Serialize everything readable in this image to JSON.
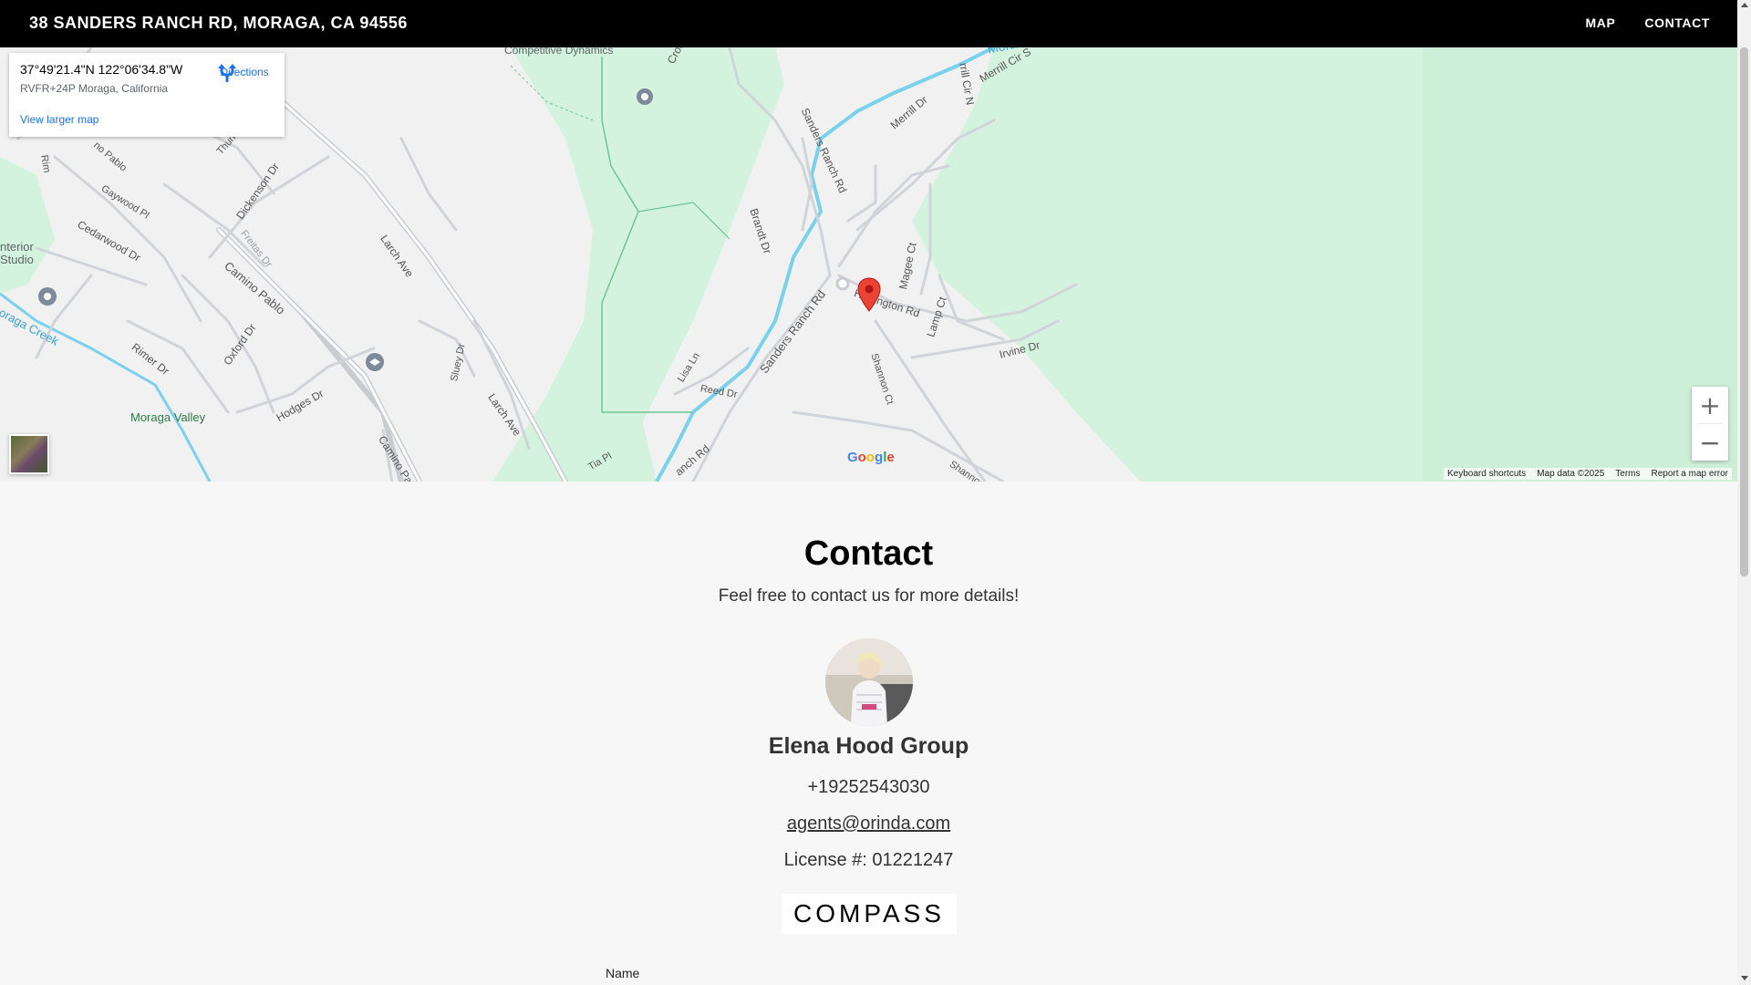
{
  "header": {
    "address": "38 SANDERS RANCH RD, MORAGA, CA 94556",
    "nav": [
      "MAP",
      "CONTACT"
    ]
  },
  "map": {
    "infobox": {
      "coords": "37°49'21.4\"N 122°06'34.8\"W",
      "plus_code": "RVFR+24P Moraga, California",
      "larger_map": "View larger map",
      "directions": "Directions"
    },
    "labels": {
      "competitive_dynamics": "Competitive Dynamics",
      "crockett": "Crockett",
      "sanders_ranch_rd_top": "Sanders Ranch Rd",
      "merrill_dr": "Merrill Dr",
      "merrill_cir_s": "Merrill Cir S",
      "merrill_cir_n": "rrill Cir N",
      "moraga_top": "Mora",
      "brandt_dr": "Brandt Dr",
      "magee_ct": "Magee Ct",
      "lamp_ct": "Lamp Ct",
      "harrington_rd": "Harrington Rd",
      "shannon_ct_1": "Shannon Ct",
      "irvine_dr": "Irvine Dr",
      "sanders_ranch_rd_mid": "Sanders Ranch Rd",
      "lisa_ln": "Lisa Ln",
      "reed_dr": "Reed Dr",
      "shannon_ct_2": "Shannon Ct",
      "ranch_rd_bottom": "anch Rd",
      "tia_pl": "Tia Pl",
      "thune": "Thune",
      "dickenson_dr": "Dickenson Dr",
      "gaywood_pl": "Gaywood Pl",
      "cedarwood_dr": "Cedarwood Dr",
      "freitas_dr": "Freitas Dr",
      "larch_ave_1": "Larch Ave",
      "camino_pablo_1": "Camino Pablo",
      "interior_studio": "nterior\nStudio",
      "moraga_creek": "oraga Creek",
      "rimer_dr": "Rimer Dr",
      "oxford_dr": "Oxford Dr",
      "moraga_valley": "Moraga Valley",
      "hodges_dr": "Hodges Dr",
      "camino_pablo_2": "Camino Pablo",
      "sluey_dr": "Sluey Dr",
      "larch_ave_2": "Larch Ave",
      "rim": "Rim",
      "ino_pablo": "no Pablo"
    },
    "google": "Google",
    "attribution": [
      "Keyboard shortcuts",
      "Map data ©2025",
      "Terms",
      "Report a map error"
    ],
    "zoom_in": "+",
    "zoom_out": "−"
  },
  "contact": {
    "title": "Contact",
    "subtitle": "Feel free to contact us for more details!",
    "agent_name": "Elena Hood Group",
    "phone": "+19252543030",
    "email": "agents@orinda.com",
    "license": "License #: 01221247",
    "brokerage_logo": "COMPASS",
    "form": {
      "name_label": "Name"
    }
  },
  "colors": {
    "header_bg": "#000000",
    "map_green": "#d4f3df",
    "water": "#7ad1ec",
    "link": "#1a73e8",
    "pin": "#ea4335"
  }
}
